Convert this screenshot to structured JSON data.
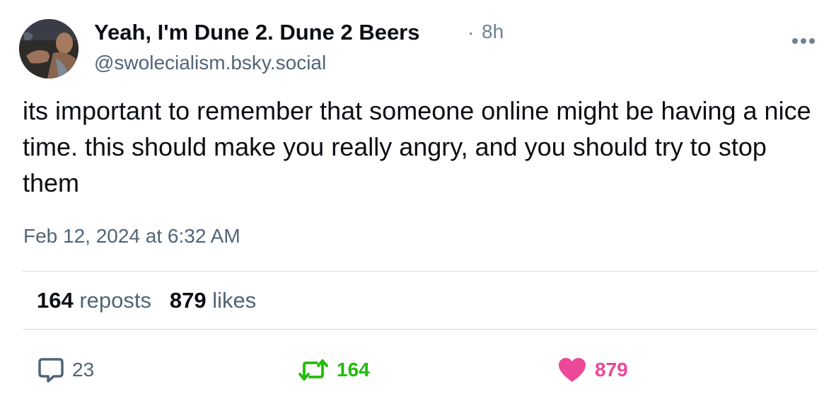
{
  "author": {
    "display_name": "Yeah, I'm Dune 2. Dune 2 Beers",
    "handle": "@swolecialism.bsky.social",
    "separator": "·",
    "relative_time": "8h"
  },
  "post": {
    "text": "its important to remember that someone online might be having a nice time. this should make you really angry, and you should try to stop them",
    "timestamp": "Feb 12, 2024 at 6:32 AM"
  },
  "stats": {
    "reposts_count": "164",
    "reposts_label": "reposts",
    "likes_count": "879",
    "likes_label": "likes"
  },
  "actions": {
    "reply_count": "23",
    "repost_count": "164",
    "like_count": "879"
  },
  "colors": {
    "text": "#0b0f14",
    "muted": "#526476",
    "repost_active": "#20bc07",
    "like_active": "#ec4899",
    "divider": "#d4dbe2"
  },
  "icons": {
    "more": "ellipsis-icon",
    "reply": "speech-bubble-icon",
    "repost": "repost-arrows-icon",
    "like": "heart-icon"
  }
}
